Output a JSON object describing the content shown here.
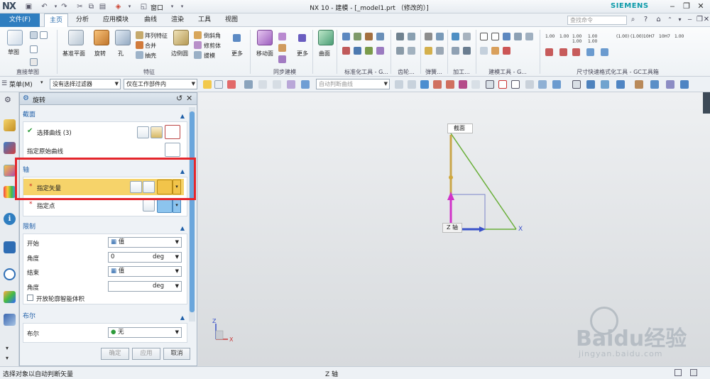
{
  "app": {
    "logo": "NX",
    "title": "NX 10 - 建模 - [_model1.prt （修改的）]",
    "brand": "SIEMENS",
    "window_menu": "窗口",
    "search_placeholder": "查找命令"
  },
  "menu": {
    "file": "文件(F)",
    "tabs": [
      "主页",
      "分析",
      "应用模块",
      "曲线",
      "渲染",
      "工具",
      "视图"
    ],
    "active_tab": "主页"
  },
  "ribbon": {
    "sketch": "草图",
    "datum_plane": "基准平面",
    "revolve": "旋转",
    "hole": "孔",
    "pattern_feature": "阵列特征",
    "unite": "合并",
    "shell": "抽壳",
    "edge_blend": "边倒圆",
    "chamfer": "倒斜角",
    "trim_body": "修剪体",
    "draft": "拔模",
    "more1": "更多",
    "move_face": "移动面",
    "more2": "更多",
    "surface": "曲面",
    "groups": [
      "直接草图",
      "特征",
      "同步建模",
      "标准化工具 - G...",
      "齿轮...",
      "弹簧...",
      "加工...",
      "建模工具 - G...",
      "尺寸快速格式化工具 - GC工具箱"
    ],
    "dim_labels": [
      "1.00",
      "1.00",
      "1.00 1.00",
      "1.00 1.00",
      "(1.00)",
      "(1.00)",
      "10H7",
      "10H7",
      "1.00"
    ]
  },
  "toolbar2": {
    "menu_btn": "菜单(M)",
    "filter": "没有选择过滤器",
    "scope": "仅在工作部件内",
    "snap": "自动判断曲线"
  },
  "dialog": {
    "title": "旋转",
    "section": {
      "label": "截面",
      "select_curve": "选择曲线 (3)",
      "specify_origin": "指定原始曲线"
    },
    "axis": {
      "label": "轴",
      "specify_vector": "指定矢量",
      "specify_point": "指定点"
    },
    "limits": {
      "label": "限制",
      "start_label": "开始",
      "start_value": "值",
      "angle_label": "角度",
      "start_angle": "0",
      "unit": "deg",
      "end_label": "结束",
      "end_value": "值",
      "end_angle": "",
      "open_profile": "开放轮廓智能体积"
    },
    "boolean": {
      "label": "布尔",
      "row_label": "布尔",
      "value": "无"
    },
    "buttons": {
      "ok": "确定",
      "apply": "应用",
      "cancel": "取消"
    }
  },
  "viewport": {
    "section_tag": "截面",
    "axis_tag": "Z 轴",
    "x_label": "X",
    "triad_z": "Z",
    "triad_x": "X",
    "watermark_brand": "Baidu经验",
    "watermark_url": "jingyan.baidu.com"
  },
  "status": {
    "left": "选择对象以自动判断矢量",
    "center": "Z 轴"
  },
  "colors": {
    "accent": "#2f7ec0",
    "highlight_row": "#f6d36a",
    "red_box": "#e5262c",
    "green_line": "#6aaf3a",
    "magenta_vector": "#d033c8",
    "blue_vector": "#3a52c9"
  }
}
